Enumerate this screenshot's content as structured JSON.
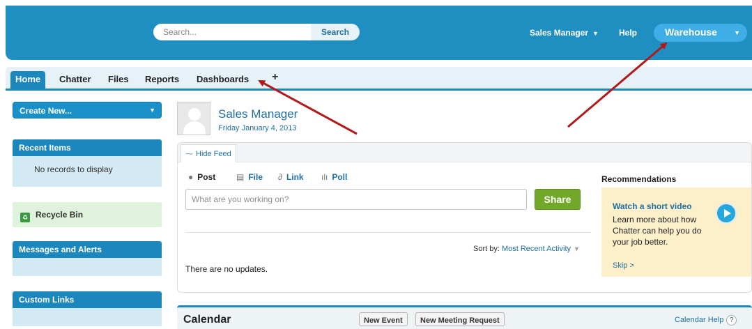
{
  "header": {
    "search_placeholder": "Search...",
    "search_button": "Search",
    "user_menu": "Sales Manager",
    "help": "Help",
    "app_switcher": "Warehouse",
    "accent_color": "#1f8fc2"
  },
  "tabs": {
    "items": [
      {
        "label": "Home",
        "active": true
      },
      {
        "label": "Chatter"
      },
      {
        "label": "Files"
      },
      {
        "label": "Reports"
      },
      {
        "label": "Dashboards"
      }
    ],
    "more": "+"
  },
  "sidebar": {
    "create_new": "Create New...",
    "recent_items_title": "Recent Items",
    "recent_items_empty": "No records to display",
    "recycle_bin": "Recycle Bin",
    "messages_title": "Messages and Alerts",
    "custom_links_title": "Custom Links"
  },
  "profile": {
    "name": "Sales Manager",
    "date": "Friday January 4, 2013"
  },
  "feed": {
    "hide_feed": "Hide Feed",
    "publisher": [
      "Post",
      "File",
      "Link",
      "Poll"
    ],
    "post_placeholder": "What are you working on?",
    "share_button": "Share",
    "sort_label": "Sort by:",
    "sort_value": "Most Recent Activity",
    "no_updates": "There are no updates."
  },
  "recommendations": {
    "title": "Recommendations",
    "head": "Watch a short video",
    "text": "Learn more about how Chatter can help you do your job better.",
    "skip": "Skip >"
  },
  "calendar": {
    "title": "Calendar",
    "new_event": "New Event",
    "new_meeting": "New Meeting Request",
    "help": "Calendar Help",
    "help_icon": "?"
  },
  "annotations": {
    "arrow_color": "#b01a1a"
  }
}
